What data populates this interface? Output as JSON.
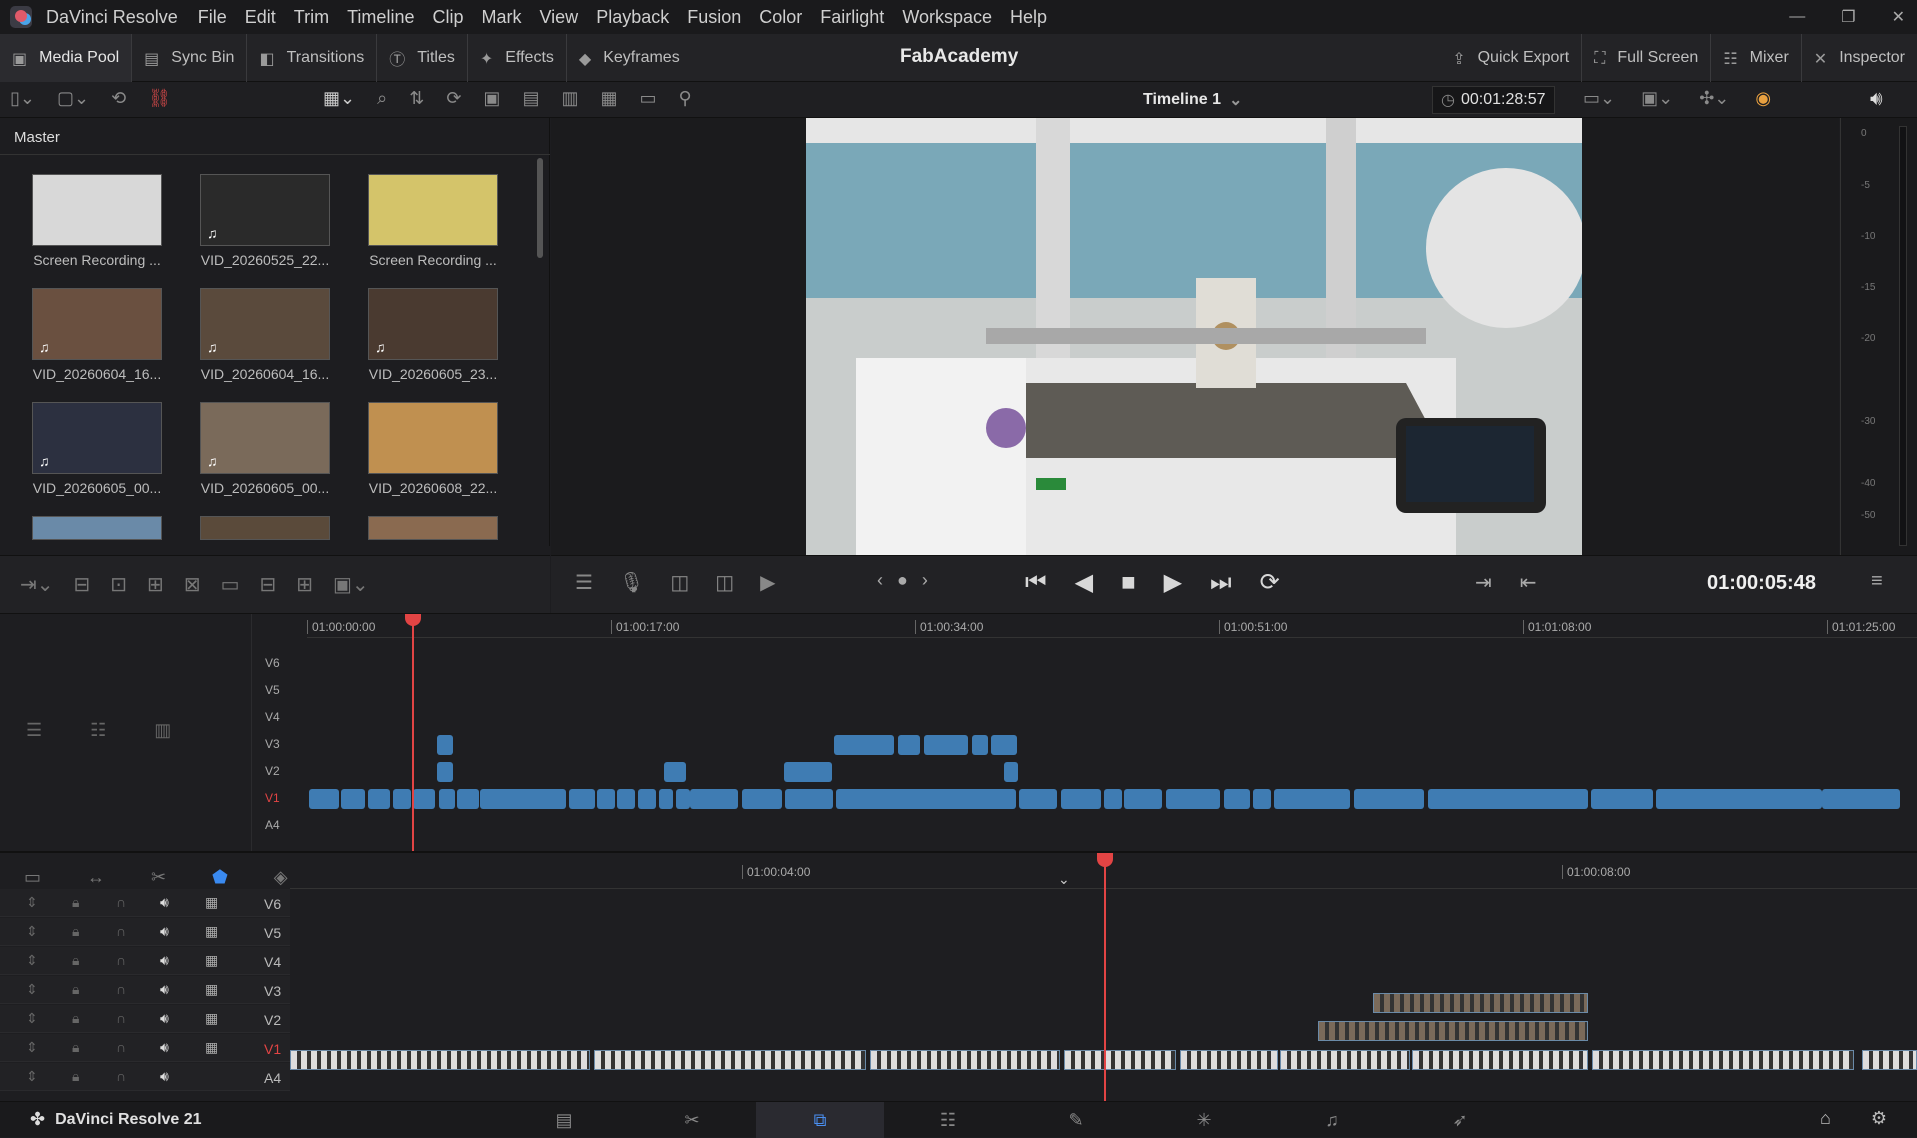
{
  "app": {
    "name": "DaVinci Resolve",
    "project": "FabAcademy",
    "brand": "DaVinci Resolve 21"
  },
  "menu": [
    "File",
    "Edit",
    "Trim",
    "Timeline",
    "Clip",
    "Mark",
    "View",
    "Playback",
    "Fusion",
    "Color",
    "Fairlight",
    "Workspace",
    "Help"
  ],
  "toolbar": {
    "media_pool": "Media Pool",
    "sync_bin": "Sync Bin",
    "transitions": "Transitions",
    "titles": "Titles",
    "effects": "Effects",
    "keyframes": "Keyframes",
    "quick_export": "Quick Export",
    "full_screen": "Full Screen",
    "mixer": "Mixer",
    "inspector": "Inspector"
  },
  "viewer": {
    "timeline_name": "Timeline 1",
    "duration": "00:01:28:57",
    "timecode": "01:00:05:48"
  },
  "mediapool": {
    "bin": "Master",
    "clips": [
      {
        "label": "Screen Recording ...",
        "color": "#d8d8d8",
        "audio": false
      },
      {
        "label": "VID_20260525_22...",
        "color": "#2a2a2a",
        "audio": true
      },
      {
        "label": "Screen Recording ...",
        "color": "#d4c46a",
        "audio": false
      },
      {
        "label": "VID_20260604_16...",
        "color": "#6a5040",
        "audio": true
      },
      {
        "label": "VID_20260604_16...",
        "color": "#5a4a3c",
        "audio": true
      },
      {
        "label": "VID_20260605_23...",
        "color": "#4a3a30",
        "audio": true
      },
      {
        "label": "VID_20260605_00...",
        "color": "#2c3040",
        "audio": true
      },
      {
        "label": "VID_20260605_00...",
        "color": "#7a6a5a",
        "audio": true
      },
      {
        "label": "VID_20260608_22...",
        "color": "#c09050",
        "audio": false
      }
    ]
  },
  "meter": {
    "ticks": [
      "0",
      "-5",
      "-10",
      "-15",
      "-20",
      "-30",
      "-40",
      "-50"
    ]
  },
  "ruler": {
    "mini": [
      "01:00:00:00",
      "01:00:17:00",
      "01:00:34:00",
      "01:00:51:00",
      "01:01:08:00",
      "01:01:25:00"
    ],
    "detail": [
      "01:00:04:00",
      "01:00:08:00"
    ]
  },
  "tracks": {
    "mini": [
      "V6",
      "V5",
      "V4",
      "V3",
      "V2",
      "V1",
      "A4"
    ],
    "detail": [
      "V6",
      "V5",
      "V4",
      "V3",
      "V2",
      "V1",
      "A4"
    ]
  },
  "pages": [
    "media",
    "cut",
    "edit",
    "fusion",
    "color",
    "fairlight",
    "deliver"
  ]
}
